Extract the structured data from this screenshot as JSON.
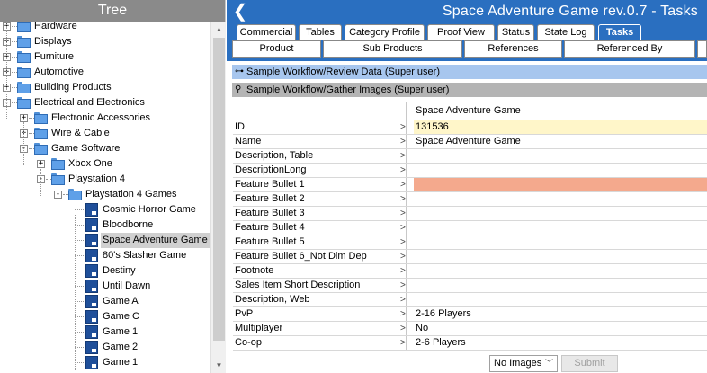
{
  "tree": {
    "title": "Tree",
    "items": [
      {
        "label": "Hardware",
        "expander": "+",
        "icon": "folder-icon"
      },
      {
        "label": "Displays",
        "expander": "+",
        "icon": "folder-icon"
      },
      {
        "label": "Furniture",
        "expander": "+",
        "icon": "folder-icon"
      },
      {
        "label": "Automotive",
        "expander": "+",
        "icon": "folder-icon"
      },
      {
        "label": "Building Products",
        "expander": "+",
        "icon": "folder-icon"
      },
      {
        "label": "Electrical and Electronics",
        "expander": "-",
        "icon": "folder-icon"
      },
      {
        "label": "Electronic Accessories",
        "expander": "+",
        "icon": "folder-icon"
      },
      {
        "label": "Wire & Cable",
        "expander": "+",
        "icon": "folder-icon"
      },
      {
        "label": "Game Software",
        "expander": "-",
        "icon": "folder-icon"
      },
      {
        "label": "Xbox One",
        "expander": "+",
        "icon": "folder-icon"
      },
      {
        "label": "Playstation 4",
        "expander": "-",
        "icon": "folder-icon"
      },
      {
        "label": "Playstation 4 Games",
        "expander": "-",
        "icon": "folder-icon"
      },
      {
        "label": "Cosmic Horror Game",
        "icon": "product-icon"
      },
      {
        "label": "Bloodborne",
        "icon": "product-icon"
      },
      {
        "label": "Space Adventure Game",
        "icon": "product-icon",
        "selected": true
      },
      {
        "label": "80's Slasher Game",
        "icon": "product-icon"
      },
      {
        "label": "Destiny",
        "icon": "product-icon"
      },
      {
        "label": "Until Dawn",
        "icon": "product-icon"
      },
      {
        "label": "Game A",
        "icon": "product-icon"
      },
      {
        "label": "Game C",
        "icon": "product-icon"
      },
      {
        "label": "Game 1",
        "icon": "product-icon"
      },
      {
        "label": "Game 2",
        "icon": "product-icon"
      },
      {
        "label": "Game 1",
        "icon": "product-icon"
      }
    ]
  },
  "header": {
    "title": "Space Adventure Game rev.0.7 - Tasks",
    "back_icon": "chevron-left-icon"
  },
  "tabs_row1": [
    "Commercial",
    "Tables",
    "Category Profile",
    "Proof View",
    "Status",
    "State Log",
    "Tasks"
  ],
  "tabs_row1_active": "Tasks",
  "tabs_row2": [
    "Product",
    "Sub Products",
    "References",
    "Referenced By"
  ],
  "sections": {
    "review": "Sample Workflow/Review Data (Super user)",
    "gather": "Sample Workflow/Gather Images (Super user)"
  },
  "grid": {
    "column_header": "Space Adventure Game",
    "rows": [
      {
        "label": "ID",
        "value": "131536",
        "highlight": "yellow"
      },
      {
        "label": "Name",
        "value": "Space Adventure Game"
      },
      {
        "label": "Description, Table",
        "value": ""
      },
      {
        "label": "DescriptionLong",
        "value": ""
      },
      {
        "label": "Feature Bullet 1",
        "value": "",
        "highlight": "orange"
      },
      {
        "label": "Feature Bullet 2",
        "value": ""
      },
      {
        "label": "Feature Bullet 3",
        "value": ""
      },
      {
        "label": "Feature Bullet 4",
        "value": ""
      },
      {
        "label": "Feature Bullet 5",
        "value": ""
      },
      {
        "label": "Feature Bullet 6_Not Dim Dep",
        "value": ""
      },
      {
        "label": "Footnote",
        "value": ""
      },
      {
        "label": "Sales Item Short Description",
        "value": ""
      },
      {
        "label": "Description, Web",
        "value": ""
      },
      {
        "label": "PvP",
        "value": "2-16 Players"
      },
      {
        "label": "Multiplayer",
        "value": "No"
      },
      {
        "label": "Co-op",
        "value": "2-6 Players"
      }
    ]
  },
  "footer": {
    "images_select": "No Images",
    "submit_label": "Submit"
  },
  "colors": {
    "accent": "#2a6fc0",
    "section_review": "#a7c6ee",
    "section_gather": "#b4b4b4",
    "highlight_yellow": "#fff6c9",
    "highlight_orange": "#f4a98d"
  }
}
